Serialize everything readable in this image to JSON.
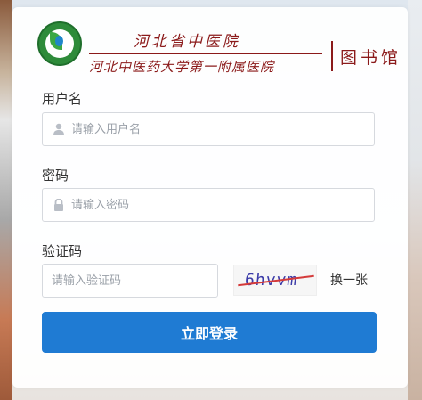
{
  "header": {
    "hospital_name": "河北省中医院",
    "hospital_affiliation": "河北中医药大学第一附属医院",
    "library_name": "图书馆"
  },
  "form": {
    "username_label": "用户名",
    "username_placeholder": "请输入用户名",
    "password_label": "密码",
    "password_placeholder": "请输入密码",
    "captcha_label": "验证码",
    "captcha_placeholder": "请输入验证码",
    "captcha_text": "6hvvm",
    "refresh_captcha_label": "换一张",
    "login_button_label": "立即登录"
  },
  "colors": {
    "brand": "#8b1a1a",
    "primary_button": "#1f7bd3",
    "logo_green": "#2e8b3a"
  },
  "icons": {
    "username_icon": "user-icon",
    "password_icon": "lock-icon",
    "logo": "hospital-emblem"
  }
}
